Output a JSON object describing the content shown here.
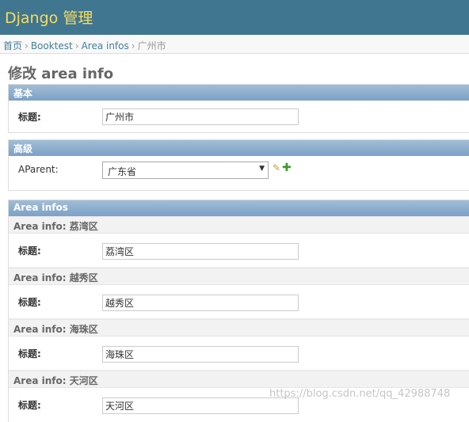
{
  "header": {
    "site_name": "Django 管理"
  },
  "breadcrumbs": {
    "home": "首页",
    "app": "Booktest",
    "model": "Area infos",
    "current": "广州市"
  },
  "page": {
    "title": "修改 area info"
  },
  "fieldset_basic": {
    "title": "基本",
    "title_label": "标题:",
    "title_value": "广州市"
  },
  "fieldset_advanced": {
    "title": "高级",
    "parent_label": "AParent:",
    "parent_value": "广东省"
  },
  "inline": {
    "title": "Area infos",
    "items": [
      {
        "heading_prefix": "Area info:",
        "heading_name": "荔湾区",
        "label": "标题:",
        "value": "荔湾区"
      },
      {
        "heading_prefix": "Area info:",
        "heading_name": "越秀区",
        "label": "标题:",
        "value": "越秀区"
      },
      {
        "heading_prefix": "Area info:",
        "heading_name": "海珠区",
        "label": "标题:",
        "value": "海珠区"
      },
      {
        "heading_prefix": "Area info:",
        "heading_name": "天河区",
        "label": "标题:",
        "value": "天河区"
      }
    ]
  },
  "watermark": "https://blog.csdn.net/qq_42988748",
  "colors": {
    "header_bg": "#417690",
    "site_name": "#f5dd5d",
    "module_header": "#7ca0c7",
    "link": "#447e9b"
  },
  "icons": {
    "edit": "pencil-icon",
    "add": "plus-icon",
    "select_arrow": "triangle-down-icon"
  }
}
